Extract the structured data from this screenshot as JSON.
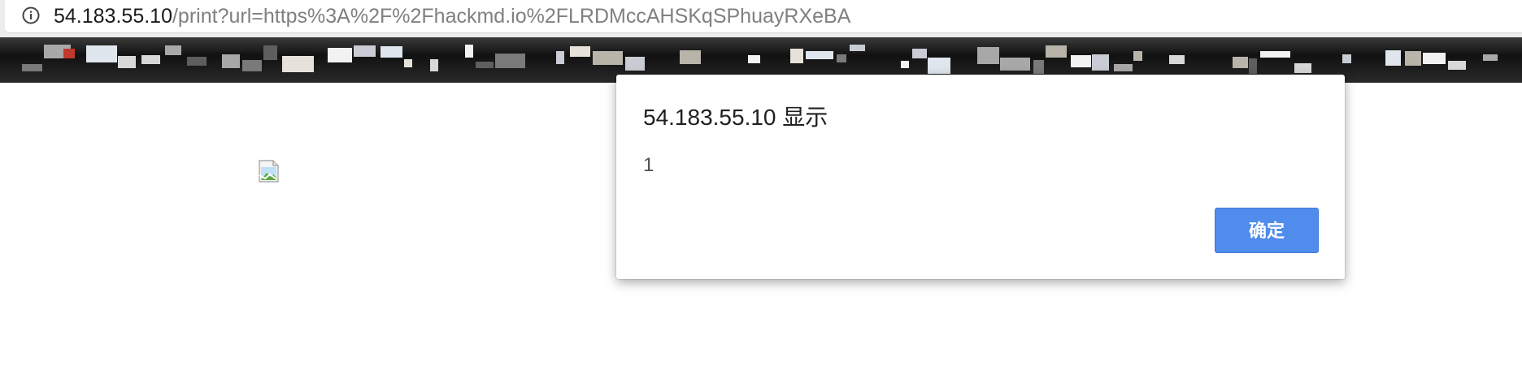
{
  "address_bar": {
    "icon": "info-icon",
    "url_host": "54.183.55.10",
    "url_rest": "/print?url=https%3A%2F%2Fhackmd.io%2FLRDMccAHSKqSPhuayRXeBA"
  },
  "bookmarks_bar": {
    "state": "pixelated"
  },
  "page": {
    "broken_image_icon": "broken-image-icon"
  },
  "alert_dialog": {
    "title": "54.183.55.10 显示",
    "message": "1",
    "ok_label": "确定",
    "ok_color": "#4f8ceb"
  }
}
